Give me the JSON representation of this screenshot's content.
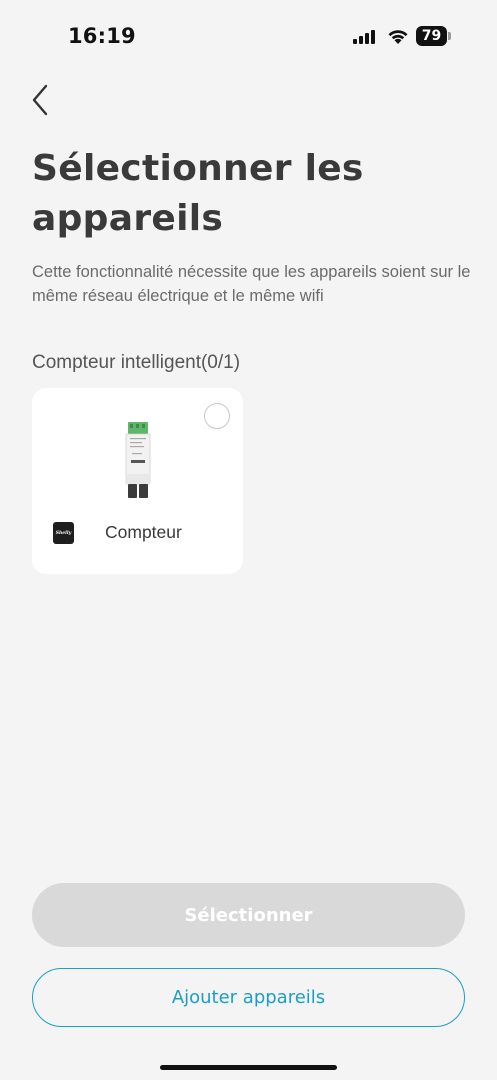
{
  "status_bar": {
    "time": "16:19",
    "battery_level": "79"
  },
  "header": {
    "back_icon": "chevron-left-icon",
    "title": "Sélectionner les appareils",
    "description": "Cette fonctionnalité nécessite que les appareils soient sur le même réseau électrique et le même wifi"
  },
  "section": {
    "label": "Compteur intelligent(0/1)"
  },
  "devices": [
    {
      "name": "Compteur",
      "brand_icon": "shelly-logo-icon",
      "image_icon": "din-rail-meter-icon",
      "selected": false
    }
  ],
  "actions": {
    "select_label": "Sélectionner",
    "add_label": "Ajouter appareils"
  },
  "colors": {
    "background": "#f4f4f4",
    "accent": "#1a9fc6",
    "disabled_button": "#d9d9d9",
    "card": "#ffffff"
  }
}
